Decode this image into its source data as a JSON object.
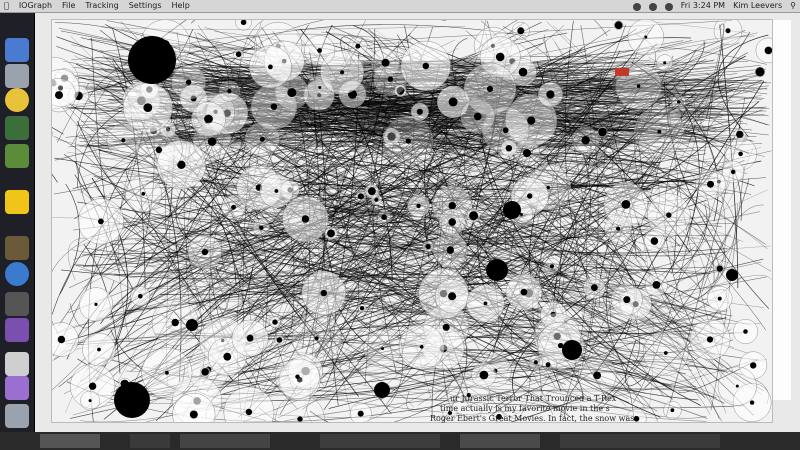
{
  "menubar": {
    "app_name": "IOGraph",
    "items": [
      "File",
      "Tracking",
      "Settings",
      "Help"
    ],
    "right_user": "Kim Leevers",
    "time": "Fri 3:24 PM"
  },
  "ghost_text": {
    "line1": "ur Jurassic Terror That Trounced a T-Rex",
    "line2": "time actually is my favorite movie in the s",
    "line3": "Roger Ebert's Great Movies. In fact, the snow was"
  },
  "colors": {
    "menubar_bg": "#d6d6d6",
    "dock_bg": "#1f2027",
    "art_bg": "#f2f2f2",
    "ink": "#000000"
  },
  "dock": {
    "items": [
      "finder-icon",
      "preview-icon",
      "chrome-icon",
      "utility-icon",
      "app-icon",
      "drive-icon",
      "photo-icon",
      "globe-icon",
      "camera-icon",
      "ethereum-icon",
      "calendar-icon",
      "ethereum2-icon",
      "trash-icon"
    ]
  }
}
